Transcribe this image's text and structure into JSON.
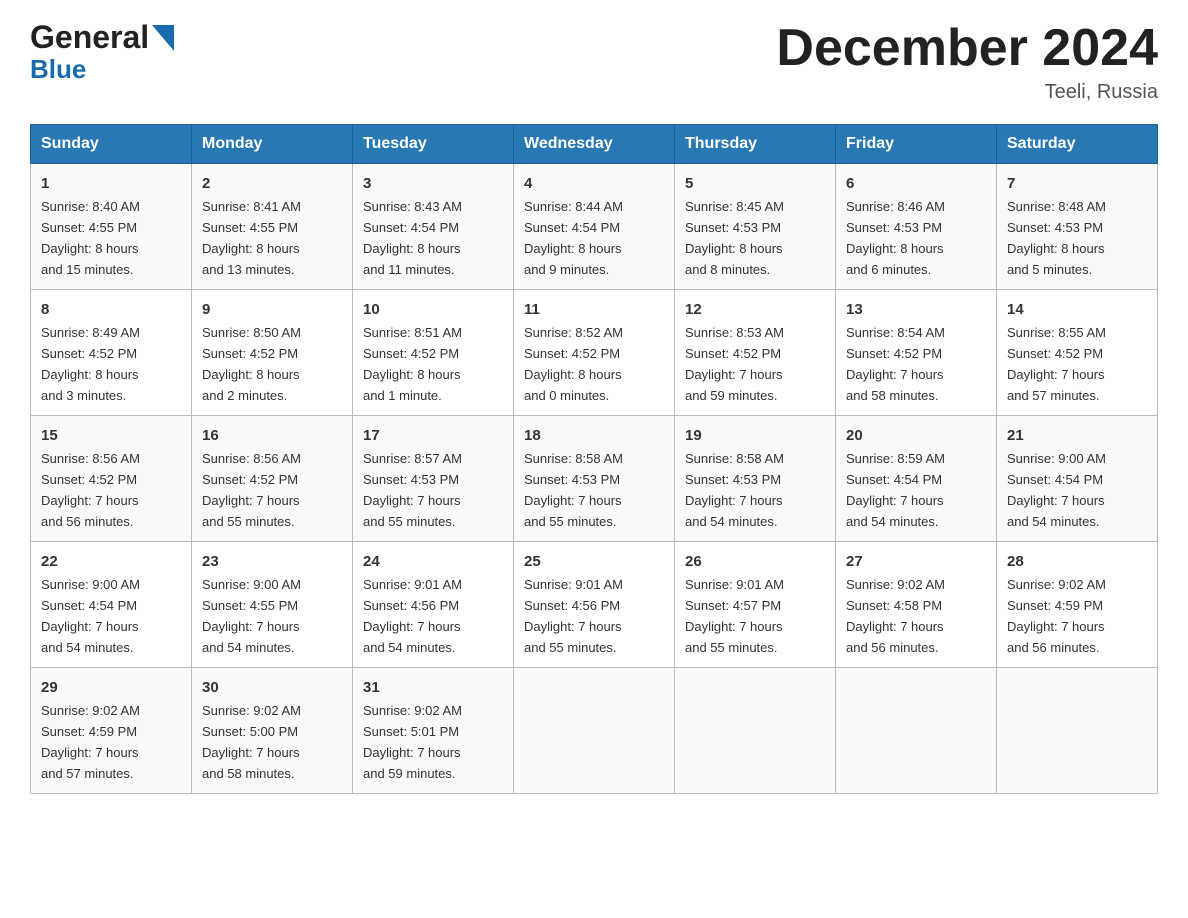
{
  "header": {
    "logo_line1": "General",
    "logo_line2": "Blue",
    "title": "December 2024",
    "location": "Teeli, Russia"
  },
  "days_of_week": [
    "Sunday",
    "Monday",
    "Tuesday",
    "Wednesday",
    "Thursday",
    "Friday",
    "Saturday"
  ],
  "weeks": [
    [
      {
        "day": "1",
        "info": "Sunrise: 8:40 AM\nSunset: 4:55 PM\nDaylight: 8 hours\nand 15 minutes."
      },
      {
        "day": "2",
        "info": "Sunrise: 8:41 AM\nSunset: 4:55 PM\nDaylight: 8 hours\nand 13 minutes."
      },
      {
        "day": "3",
        "info": "Sunrise: 8:43 AM\nSunset: 4:54 PM\nDaylight: 8 hours\nand 11 minutes."
      },
      {
        "day": "4",
        "info": "Sunrise: 8:44 AM\nSunset: 4:54 PM\nDaylight: 8 hours\nand 9 minutes."
      },
      {
        "day": "5",
        "info": "Sunrise: 8:45 AM\nSunset: 4:53 PM\nDaylight: 8 hours\nand 8 minutes."
      },
      {
        "day": "6",
        "info": "Sunrise: 8:46 AM\nSunset: 4:53 PM\nDaylight: 8 hours\nand 6 minutes."
      },
      {
        "day": "7",
        "info": "Sunrise: 8:48 AM\nSunset: 4:53 PM\nDaylight: 8 hours\nand 5 minutes."
      }
    ],
    [
      {
        "day": "8",
        "info": "Sunrise: 8:49 AM\nSunset: 4:52 PM\nDaylight: 8 hours\nand 3 minutes."
      },
      {
        "day": "9",
        "info": "Sunrise: 8:50 AM\nSunset: 4:52 PM\nDaylight: 8 hours\nand 2 minutes."
      },
      {
        "day": "10",
        "info": "Sunrise: 8:51 AM\nSunset: 4:52 PM\nDaylight: 8 hours\nand 1 minute."
      },
      {
        "day": "11",
        "info": "Sunrise: 8:52 AM\nSunset: 4:52 PM\nDaylight: 8 hours\nand 0 minutes."
      },
      {
        "day": "12",
        "info": "Sunrise: 8:53 AM\nSunset: 4:52 PM\nDaylight: 7 hours\nand 59 minutes."
      },
      {
        "day": "13",
        "info": "Sunrise: 8:54 AM\nSunset: 4:52 PM\nDaylight: 7 hours\nand 58 minutes."
      },
      {
        "day": "14",
        "info": "Sunrise: 8:55 AM\nSunset: 4:52 PM\nDaylight: 7 hours\nand 57 minutes."
      }
    ],
    [
      {
        "day": "15",
        "info": "Sunrise: 8:56 AM\nSunset: 4:52 PM\nDaylight: 7 hours\nand 56 minutes."
      },
      {
        "day": "16",
        "info": "Sunrise: 8:56 AM\nSunset: 4:52 PM\nDaylight: 7 hours\nand 55 minutes."
      },
      {
        "day": "17",
        "info": "Sunrise: 8:57 AM\nSunset: 4:53 PM\nDaylight: 7 hours\nand 55 minutes."
      },
      {
        "day": "18",
        "info": "Sunrise: 8:58 AM\nSunset: 4:53 PM\nDaylight: 7 hours\nand 55 minutes."
      },
      {
        "day": "19",
        "info": "Sunrise: 8:58 AM\nSunset: 4:53 PM\nDaylight: 7 hours\nand 54 minutes."
      },
      {
        "day": "20",
        "info": "Sunrise: 8:59 AM\nSunset: 4:54 PM\nDaylight: 7 hours\nand 54 minutes."
      },
      {
        "day": "21",
        "info": "Sunrise: 9:00 AM\nSunset: 4:54 PM\nDaylight: 7 hours\nand 54 minutes."
      }
    ],
    [
      {
        "day": "22",
        "info": "Sunrise: 9:00 AM\nSunset: 4:54 PM\nDaylight: 7 hours\nand 54 minutes."
      },
      {
        "day": "23",
        "info": "Sunrise: 9:00 AM\nSunset: 4:55 PM\nDaylight: 7 hours\nand 54 minutes."
      },
      {
        "day": "24",
        "info": "Sunrise: 9:01 AM\nSunset: 4:56 PM\nDaylight: 7 hours\nand 54 minutes."
      },
      {
        "day": "25",
        "info": "Sunrise: 9:01 AM\nSunset: 4:56 PM\nDaylight: 7 hours\nand 55 minutes."
      },
      {
        "day": "26",
        "info": "Sunrise: 9:01 AM\nSunset: 4:57 PM\nDaylight: 7 hours\nand 55 minutes."
      },
      {
        "day": "27",
        "info": "Sunrise: 9:02 AM\nSunset: 4:58 PM\nDaylight: 7 hours\nand 56 minutes."
      },
      {
        "day": "28",
        "info": "Sunrise: 9:02 AM\nSunset: 4:59 PM\nDaylight: 7 hours\nand 56 minutes."
      }
    ],
    [
      {
        "day": "29",
        "info": "Sunrise: 9:02 AM\nSunset: 4:59 PM\nDaylight: 7 hours\nand 57 minutes."
      },
      {
        "day": "30",
        "info": "Sunrise: 9:02 AM\nSunset: 5:00 PM\nDaylight: 7 hours\nand 58 minutes."
      },
      {
        "day": "31",
        "info": "Sunrise: 9:02 AM\nSunset: 5:01 PM\nDaylight: 7 hours\nand 59 minutes."
      },
      {
        "day": "",
        "info": ""
      },
      {
        "day": "",
        "info": ""
      },
      {
        "day": "",
        "info": ""
      },
      {
        "day": "",
        "info": ""
      }
    ]
  ]
}
